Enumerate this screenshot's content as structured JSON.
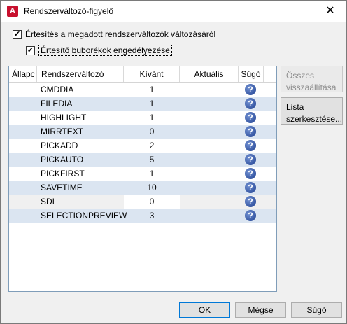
{
  "window": {
    "title": "Rendszerváltozó-figyelő",
    "close": "✕",
    "app_icon_letter": "A"
  },
  "options": {
    "notify_label": "Értesítés a megadott rendszerváltozók változásáról",
    "balloon_label": "Értesítő buborékok engedélyezése",
    "notify_checked": true,
    "balloon_checked": true
  },
  "table": {
    "headers": {
      "status": "Állapc",
      "variable": "Rendszerváltozó",
      "wanted": "Kívánt",
      "current": "Aktuális",
      "help": "Súgó"
    },
    "rows": [
      {
        "variable": "CMDDIA",
        "wanted": "1"
      },
      {
        "variable": "FILEDIA",
        "wanted": "1"
      },
      {
        "variable": "HIGHLIGHT",
        "wanted": "1"
      },
      {
        "variable": "MIRRTEXT",
        "wanted": "0"
      },
      {
        "variable": "PICKADD",
        "wanted": "2"
      },
      {
        "variable": "PICKAUTO",
        "wanted": "5"
      },
      {
        "variable": "PICKFIRST",
        "wanted": "1"
      },
      {
        "variable": "SAVETIME",
        "wanted": "10"
      },
      {
        "variable": "SDI",
        "wanted": "0"
      },
      {
        "variable": "SELECTIONPREVIEW",
        "wanted": "3"
      }
    ]
  },
  "side_buttons": {
    "reset_all": "Összes visszaállítása",
    "edit_list": "Lista szerkesztése..."
  },
  "footer": {
    "ok": "OK",
    "cancel": "Mégse",
    "help": "Súgó"
  },
  "colors": {
    "row_alt": "#dbe5f1",
    "help_icon": "#1e3f8f",
    "brand": "#c8102e"
  }
}
